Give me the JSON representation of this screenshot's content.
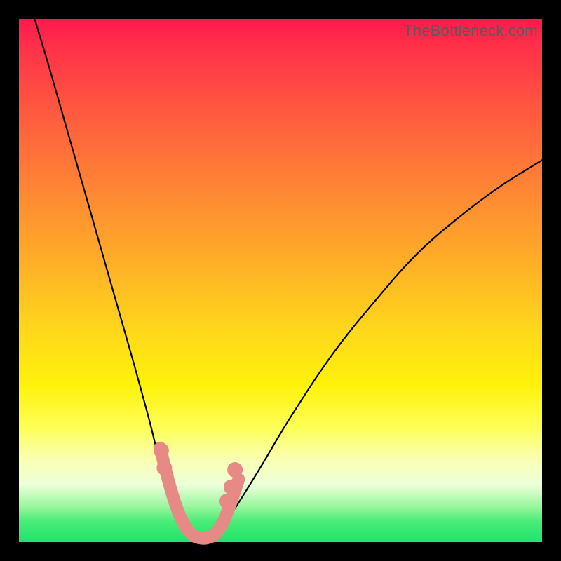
{
  "watermark": "TheBottleneck.com",
  "colors": {
    "background_frame": "#000000",
    "gradient_top": "#ff1a4d",
    "gradient_bottom": "#1ee46c",
    "curve": "#000000",
    "highlight": "#e78a86",
    "watermark_text": "#5a5a5a"
  },
  "chart_data": {
    "type": "line",
    "title": "",
    "xlabel": "",
    "ylabel": "",
    "xlim": [
      0,
      100
    ],
    "ylim": [
      0,
      100
    ],
    "grid": false,
    "legend": false,
    "series": [
      {
        "name": "bottleneck-curve",
        "x": [
          3,
          6,
          10,
          14,
          18,
          22,
          25,
          27,
          29,
          30.5,
          32,
          34,
          36,
          38,
          41,
          46,
          52,
          60,
          68,
          76,
          84,
          92,
          100
        ],
        "y": [
          100,
          90,
          76,
          62,
          48,
          34,
          23,
          15,
          9,
          5,
          2,
          0.5,
          0.5,
          2,
          6,
          14,
          24,
          36,
          46,
          55,
          62,
          68,
          73
        ]
      }
    ],
    "highlight_segment": {
      "name": "near-zero-band",
      "x": [
        27,
        28.5,
        30,
        31.5,
        33,
        34.5,
        36,
        37.5,
        39,
        40.5,
        42
      ],
      "y": [
        18,
        12,
        7,
        3.5,
        1.5,
        0.8,
        0.8,
        1.6,
        3.8,
        7.5,
        12
      ]
    },
    "highlight_dots": [
      {
        "x": 27.2,
        "y": 17.5
      },
      {
        "x": 27.8,
        "y": 14.2
      },
      {
        "x": 39.8,
        "y": 7.8
      },
      {
        "x": 40.6,
        "y": 10.5
      },
      {
        "x": 41.3,
        "y": 13.8
      }
    ]
  }
}
